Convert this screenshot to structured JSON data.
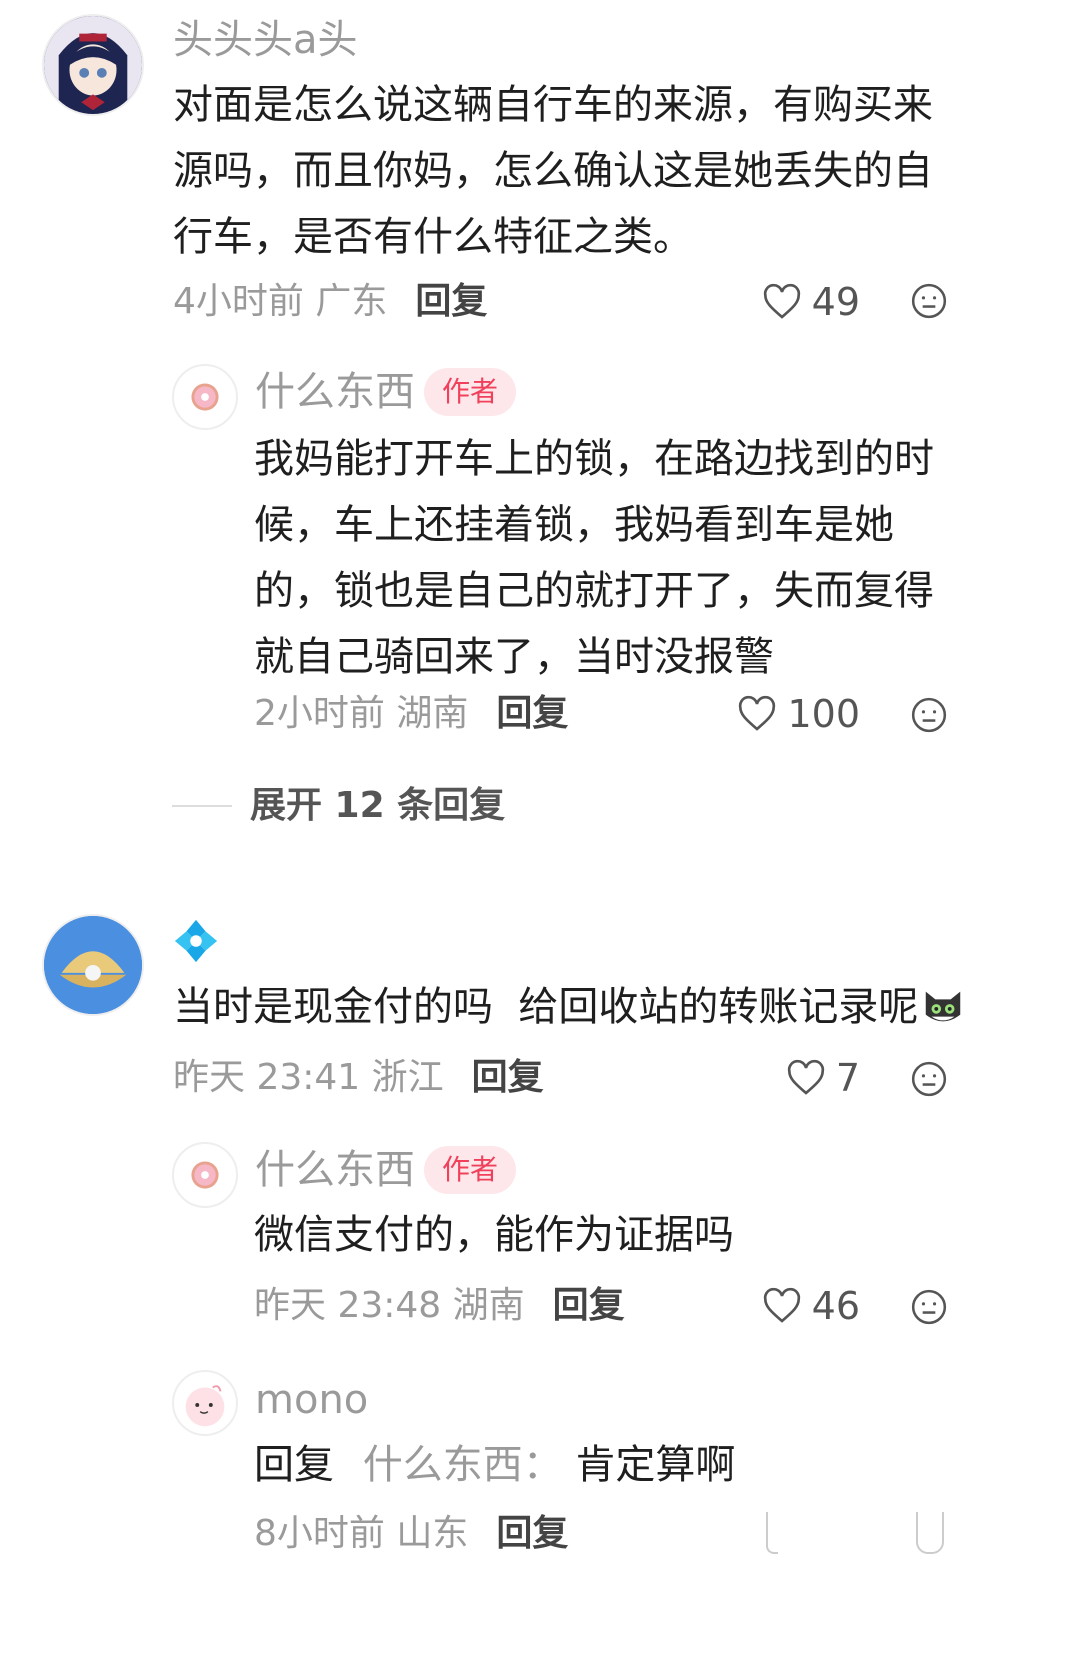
{
  "comments": [
    {
      "username": "头头头a头",
      "text": "对面是怎么说这辆自行车的来源，有购买来源吗，而且你妈，怎么确认这是她丢失的自行车，是否有什么特征之类。",
      "meta": "4小时前 广东",
      "reply_label": "回复",
      "likes": "49"
    },
    {
      "username": "什么东西",
      "badge": "作者",
      "text": "我妈能打开车上的锁，在路边找到的时候，车上还挂着锁，我妈看到车是她的，锁也是自己的就打开了，失而复得就自己骑回来了，当时没报警",
      "meta": "2小时前 湖南",
      "reply_label": "回复",
      "likes": "100"
    },
    {
      "expand_label": "展开 12 条回复"
    },
    {
      "username": "",
      "text": "当时是现金付的吗  给回收站的转账记录呢",
      "meta": "昨天 23:41 浙江",
      "reply_label": "回复",
      "likes": "7"
    },
    {
      "username": "什么东西",
      "badge": "作者",
      "text": "微信支付的，能作为证据吗",
      "meta": "昨天 23:48 湖南",
      "reply_label": "回复",
      "likes": "46"
    },
    {
      "username": "mono",
      "reply_prefix": "回复",
      "reply_to": "什么东西：",
      "text": "肯定算啊",
      "meta": "8小时前 山东",
      "reply_label": "回复"
    }
  ],
  "colors": {
    "accent": "#f0405b",
    "muted": "#9a9a9a",
    "text": "#1f1f1f"
  }
}
